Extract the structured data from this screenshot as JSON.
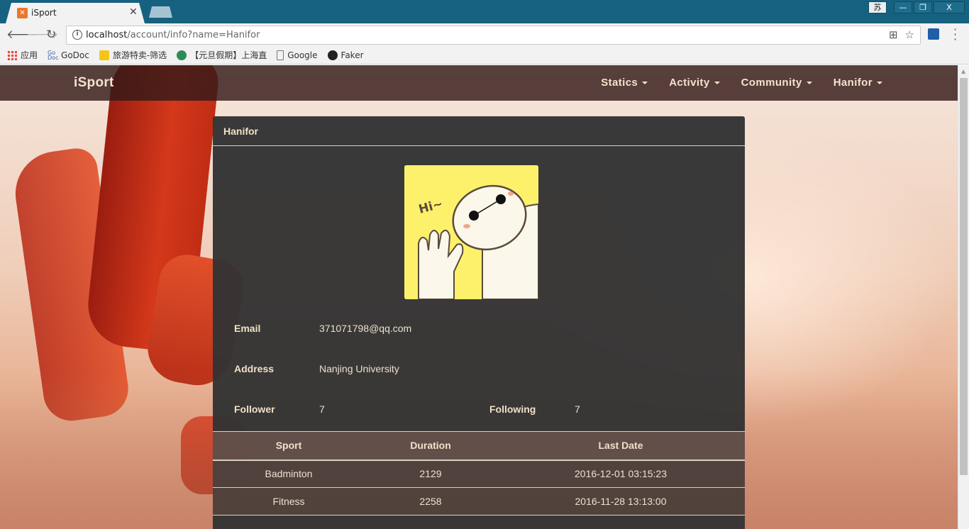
{
  "browser": {
    "tab_title": "iSport",
    "url_host": "localhost",
    "url_path": "/account/info?name=Hanifor",
    "bookmarks": [
      "应用",
      "GoDoc",
      "旅游特卖-筛选",
      "【元旦假期】上海直",
      "Google",
      "Faker"
    ],
    "user_badge": "苏"
  },
  "navbar": {
    "brand": "iSport",
    "links": [
      "Statics",
      "Activity",
      "Community",
      "Hanifor"
    ]
  },
  "profile": {
    "header": "Hanifor",
    "avatar_text": "Hi~",
    "email_label": "Email",
    "email": "371071798@qq.com",
    "address_label": "Address",
    "address": "Nanjing University",
    "follower_label": "Follower",
    "follower": "7",
    "following_label": "Following",
    "following": "7"
  },
  "sports_table": {
    "headers": [
      "Sport",
      "Duration",
      "Last Date"
    ],
    "rows": [
      [
        "Badminton",
        "2129",
        "2016-12-01 03:15:23"
      ],
      [
        "Fitness",
        "2258",
        "2016-11-28 13:13:00"
      ]
    ]
  },
  "colors": {
    "browser_frame": "#16617f",
    "navbar_bg": "#341a18",
    "card_bg": "#343434",
    "text_accent": "#f1e0c7"
  }
}
